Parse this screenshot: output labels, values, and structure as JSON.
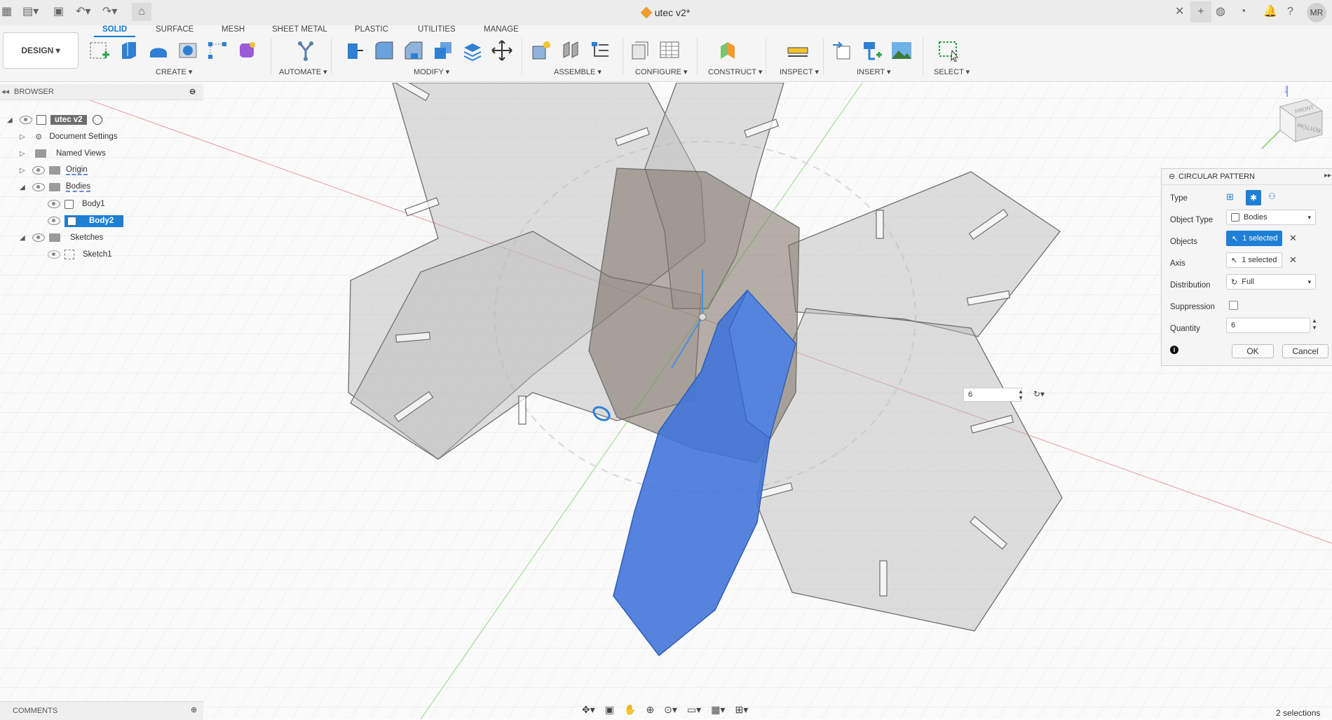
{
  "window": {
    "title": "utec v2*"
  },
  "toolbar": {
    "workspace_label": "DESIGN",
    "tabs": [
      "SOLID",
      "SURFACE",
      "MESH",
      "SHEET METAL",
      "PLASTIC",
      "UTILITIES",
      "MANAGE"
    ],
    "groups": [
      "CREATE",
      "AUTOMATE",
      "MODIFY",
      "ASSEMBLE",
      "CONFIGURE",
      "CONSTRUCT",
      "INSPECT",
      "INSERT",
      "SELECT"
    ]
  },
  "browser": {
    "header": "BROWSER",
    "items": [
      {
        "label": "utec v2"
      },
      {
        "label": "Document Settings"
      },
      {
        "label": "Named Views"
      },
      {
        "label": "Origin"
      },
      {
        "label": "Bodies"
      },
      {
        "label": "Body1"
      },
      {
        "label": "Body2"
      },
      {
        "label": "Sketches"
      },
      {
        "label": "Sketch1"
      }
    ]
  },
  "dialog": {
    "title": "CIRCULAR PATTERN",
    "labels": {
      "type": "Type",
      "object_type": "Object Type",
      "objects": "Objects",
      "axis": "Axis",
      "distribution": "Distribution",
      "suppression": "Suppression",
      "quantity": "Quantity"
    },
    "object_type_value": "Bodies",
    "objects_value": "1 selected",
    "axis_value": "1 selected",
    "distribution_value": "Full",
    "quantity_value": "6",
    "ok_label": "OK",
    "cancel_label": "Cancel"
  },
  "canvas": {
    "quantity_input": "6",
    "viewcube": {
      "top": "Z",
      "front": "FRONT",
      "bottom": "BOTTOM"
    }
  },
  "comments": {
    "header": "COMMENTS"
  },
  "status": {
    "selections": "2 selections"
  },
  "user": {
    "initials": "MR"
  },
  "colors": {
    "accent": "#0a7bd6",
    "selected_body": "#3f73d8",
    "panel_fill": "#b7b7b7"
  }
}
